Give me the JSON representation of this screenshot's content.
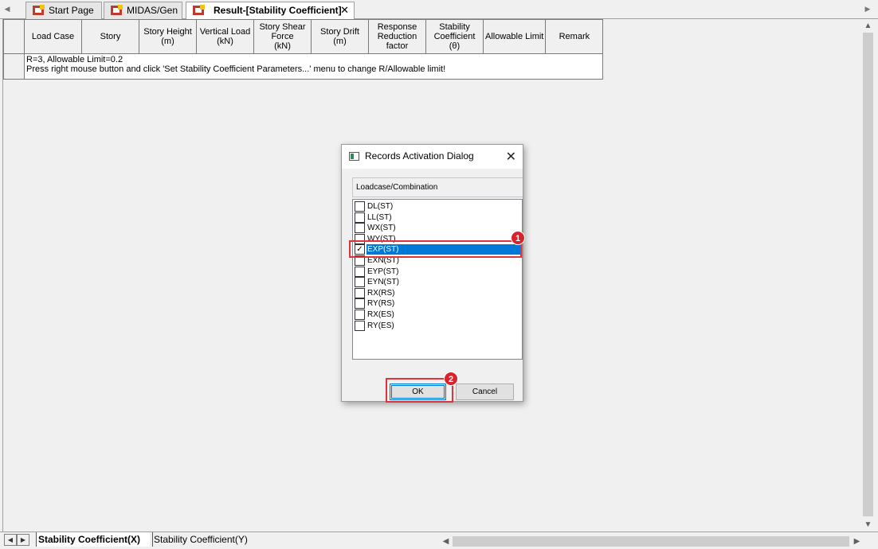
{
  "tabs": [
    {
      "label": "Start Page",
      "icon": "midas-app-icon"
    },
    {
      "label": "MIDAS/Gen",
      "icon": "midas-app-icon"
    },
    {
      "label": "Result-[Stability Coefficient]",
      "icon": "midas-app-icon",
      "active": true,
      "close": "✕"
    }
  ],
  "table": {
    "headers": [
      "",
      "Load Case",
      "Story",
      "Story Height\n(m)",
      "Vertical Load\n(kN)",
      "Story Shear\nForce\n(kN)",
      "Story Drift\n(m)",
      "Response\nReduction\nfactor",
      "Stability\nCoefficient\n(θ)",
      "Allowable Limit",
      "Remark"
    ],
    "note_line1": "R=3, Allowable Limit=0.2",
    "note_line2": "Press right mouse button and click 'Set Stability Coefficient Parameters...' menu to change R/Allowable limit!"
  },
  "dialog": {
    "title": "Records Activation Dialog",
    "close": "✕",
    "column_header": "Loadcase/Combination",
    "items": [
      {
        "label": "DL(ST)",
        "checked": false
      },
      {
        "label": "LL(ST)",
        "checked": false
      },
      {
        "label": "WX(ST)",
        "checked": false
      },
      {
        "label": "WY(ST)",
        "checked": false
      },
      {
        "label": "EXP(ST)",
        "checked": true,
        "selected": true
      },
      {
        "label": "EXN(ST)",
        "checked": false
      },
      {
        "label": "EYP(ST)",
        "checked": false
      },
      {
        "label": "EYN(ST)",
        "checked": false
      },
      {
        "label": "RX(RS)",
        "checked": false
      },
      {
        "label": "RY(RS)",
        "checked": false
      },
      {
        "label": "RX(ES)",
        "checked": false
      },
      {
        "label": "RY(ES)",
        "checked": false
      }
    ],
    "ok_label": "OK",
    "cancel_label": "Cancel"
  },
  "annotations": {
    "badge1": "1",
    "badge2": "2"
  },
  "sheet_tabs": [
    {
      "label": "Stability Coefficient(X)",
      "active": true
    },
    {
      "label": "Stability Coefficient(Y)",
      "active": false
    }
  ],
  "colors": {
    "selection": "#0078d7",
    "annotation": "#e0343c"
  }
}
